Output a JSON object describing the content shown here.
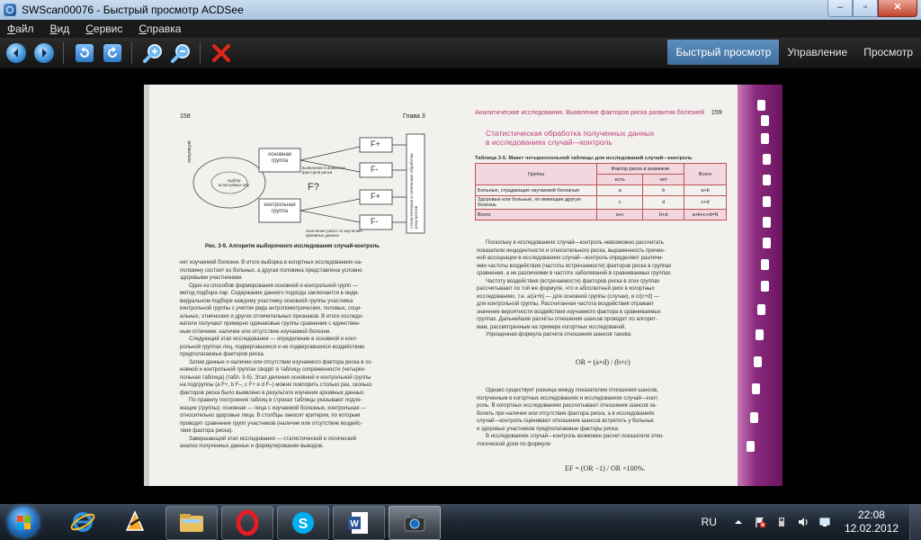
{
  "window": {
    "title": "SWScan00076 - Быстрый просмотр ACDSee",
    "min_label": "–",
    "max_label": "▫",
    "close_label": "✕"
  },
  "menu": [
    "Файл",
    "Вид",
    "Сервис",
    "Справка"
  ],
  "mode_tabs": [
    "Быстрый просмотр",
    "Управление",
    "Просмотр"
  ],
  "colors": {
    "accent": "#4f80b0",
    "heading_pink": "#c0417a",
    "taskbar": "#1e2733"
  },
  "toolbar": {
    "icons": [
      "back-arrow-icon",
      "forward-arrow-icon",
      "rotate-left-icon",
      "rotate-right-icon",
      "zoom-in-icon",
      "zoom-out-icon",
      "delete-icon"
    ]
  },
  "doc": {
    "left_page_number": "158",
    "left_header": "Глава 3",
    "right_header": "Аналитические исследования. Выявление факторов риска развития болезней",
    "right_page_number": "159",
    "diagram": {
      "population": "популяция",
      "cloud": "подбор испытуемых пар",
      "main_group": "основная группа",
      "control_group": "контрольная группа",
      "risk_factor": "выявление в анамнезе факторов риска",
      "question": "F?",
      "f_plus_1": "F+",
      "f_minus_1": "F-",
      "f_plus_2": "F+",
      "f_minus_2": "F-",
      "stats": "статистическая и логическая обработка результатов",
      "archive": "окончание работ по изучению архивных данных"
    },
    "figure_caption": "Рис. 3-9. Алгоритм выборочного исследования случай-контроль",
    "left_paragraphs": [
      "нет изучаемой болезни. В итоге выборка в когортных исследованиях на-",
      "половину состоит из больных, а другая половина представлена условно",
      "здоровыми участниками.",
      "Один из способов формирования основной и контрольной групп —",
      "метод подбора пар. Содержание данного подхода заключается в инди-",
      "видуальном подборе каждому участнику основной группы участника",
      "контрольной группы с учетом ряда антропометрических, половых, соци-",
      "альных, этнических и других отличительных признаков. В итоге исследо-",
      "ватели получают примерно одинаковые группы сравнения с единствен-",
      "ным отличием: наличие или отсутствие изучаемой болезни.",
      "Следующий этап исследования — определение в основной и конт-",
      "рольной группах лиц, подвергавшихся и не подвергавшихся воздействию",
      "предполагаемых факторов риска.",
      "Затем данные о наличии или отсутствии изучаемого фактора риска в ос-",
      "новной и контрольной группах сводят в таблицу сопряженности (четырех-",
      "польная таблица) (табл. 3-5). Этап деления основной и контрольной группы",
      "на подгруппы (a F+, b F–, c F+ и d F–) можно повторить столько раз, сколько",
      "факторов риска было выявлено в результате изучения архивных данных.",
      "По правилу построения таблиц в строках таблицы указывают подле-",
      "жащие (группы): основная — лица с изучаемой болезнью, контрольная —",
      "относительно здоровые лица. В столбцы заносят критерии, по которым",
      "проводят сравнение групп участников (наличие или отсутствие воздейс-",
      "твия фактора риска).",
      "Завершающий этап исследования — статистический и логический",
      "анализ полученных данных и формулирование выводов."
    ],
    "right_heading_1": "Статистическая обработка полученных данных",
    "right_heading_2": "в исследованиях случай—контроль",
    "table_caption": "Таблица 3-5. Макет четырехпольной таблицы для исследований случай—контроль",
    "table": {
      "col_groups": "Группы",
      "col_factor": "Фактор риска в анамнезе",
      "col_total": "Всего",
      "col_yes": "есть",
      "col_no": "нет",
      "rows": [
        {
          "label": "Больные, страдающие изучаемой болезнью",
          "a": "a",
          "b": "b",
          "t": "a+b"
        },
        {
          "label": "Здоровые или больные, но имеющие другую болезнь",
          "a": "c",
          "b": "d",
          "t": "c+d"
        },
        {
          "label": "Всего",
          "a": "a+c",
          "b": "b+d",
          "t": "a+b+c+d=N"
        }
      ]
    },
    "right_paragraphs": [
      "Поскольку в исследованиях случай—контроль невозможно рассчитать",
      "показатели инцидентности и относительного риска, выраженность причин-",
      "ной ассоциации в исследованиях случай—контроль определяют различи-",
      "ями частоты воздействия (частоты встречаемости) факторов риска в группах",
      "сравнения, а не различиями в частоте заболеваний в сравниваемых группах.",
      "Частоту воздействия (встречаемости) факторов риска в этих группах",
      "рассчитывают по той же формуле, что и абсолютный риск в когортных",
      "исследованиях, т.е. a/(a+b) — для основной группы (случаи), и c/(c+d) —",
      "для контрольной группы. Рассчитанная частота воздействия отражает",
      "значение вероятности воздействия изучаемого фактора в сравниваемых",
      "группах. Дальнейшие расчёты отношения шансов проводят по алгорит-",
      "мам, рассмотренным на примере когортных исследований.",
      "Упрощенная формула расчета отношения шансов такова:"
    ],
    "formula_or": "OR = (a×d) / (b×c)",
    "right_paragraphs_2": [
      "Однако существует разница между показателем отношения шансов,",
      "полученным в когортных исследованиях и исследованиях случай—конт-",
      "роль. В когортных исследованиях рассчитывают отношение шансов за-",
      "болеть при наличии или отсутствия фактора риска, а в исследованиях",
      "случай—контроль оценивают отношение шансов встретить у больных",
      "и здоровых участников предполагаемые факторы риска.",
      "В исследованиях случай—контроль возможен расчет показателя этио-",
      "логической доли по формуле"
    ],
    "formula_ef": "EF = (OR −1) / OR ×100%."
  },
  "taskbar": {
    "apps": [
      "ie-icon",
      "winamp-icon",
      "file-explorer-icon",
      "opera-icon",
      "skype-icon",
      "word-icon",
      "acdsee-icon"
    ],
    "lang": "RU",
    "time": "22:08",
    "date": "12.02.2012"
  }
}
